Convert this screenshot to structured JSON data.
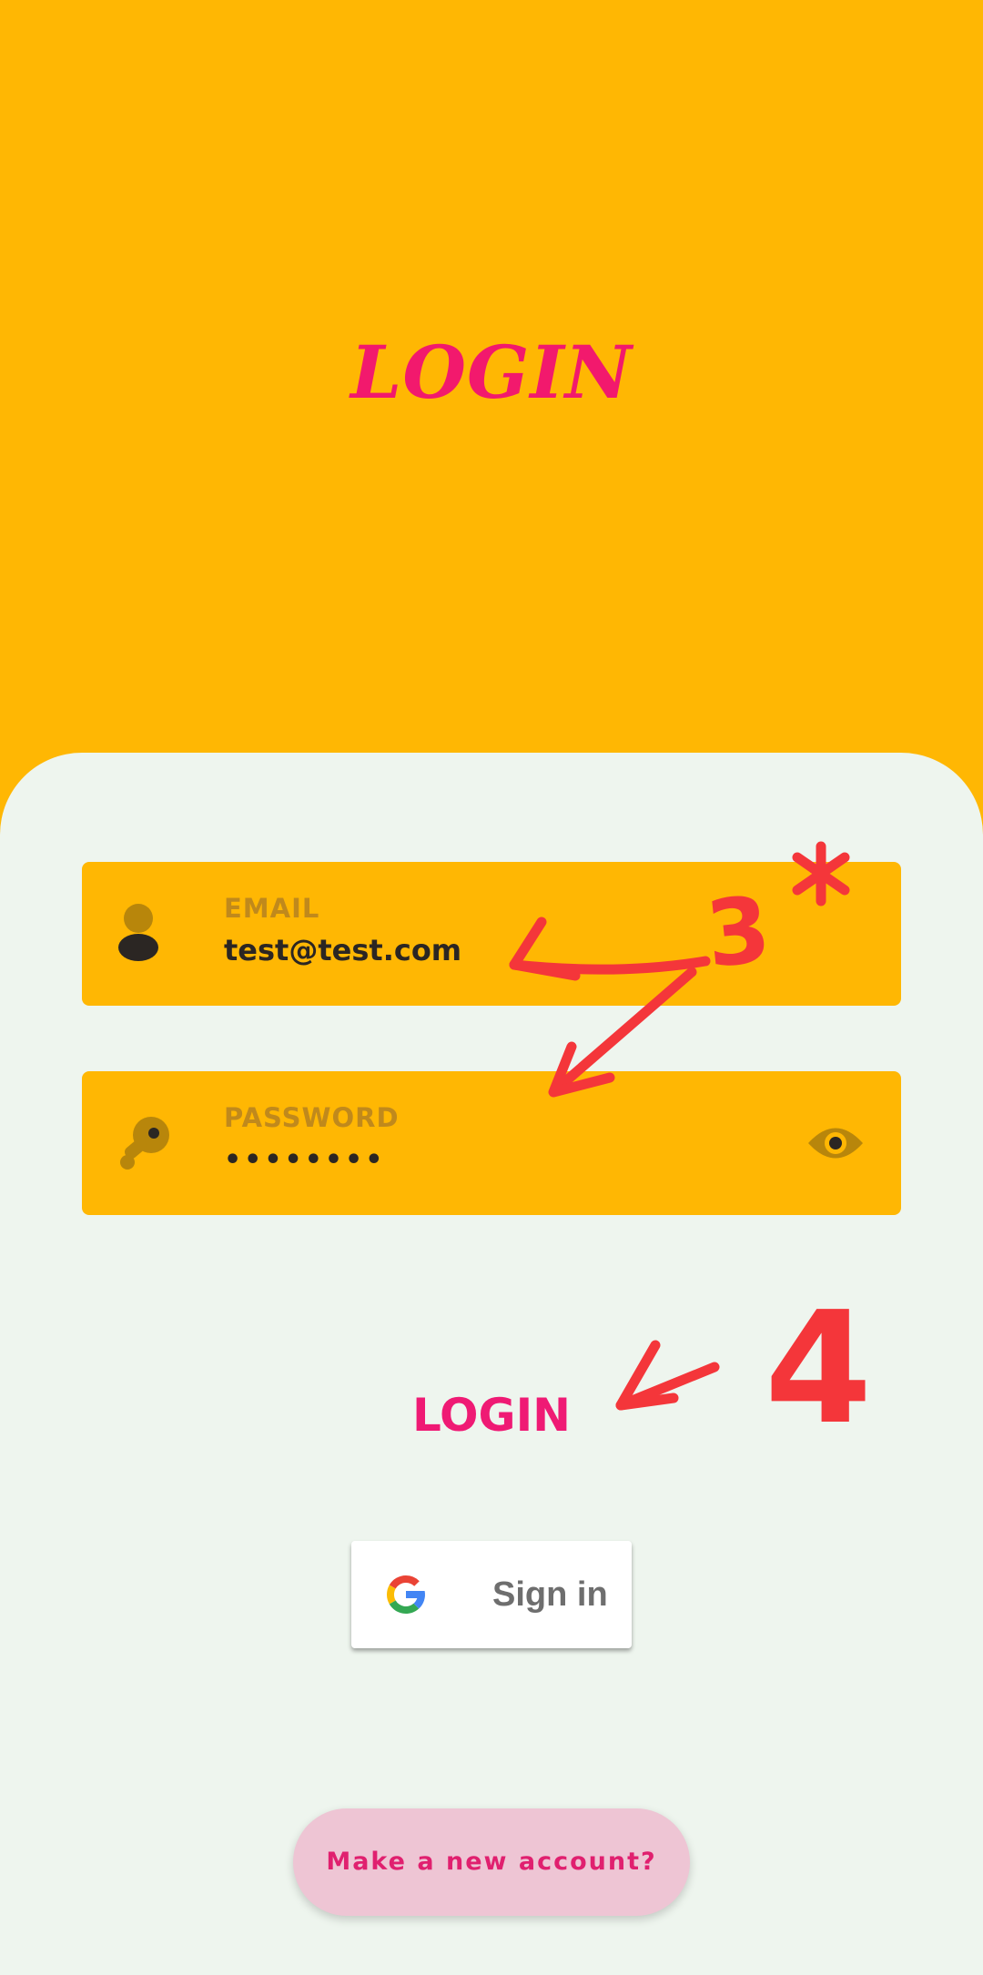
{
  "header": {
    "title": "LOGIN"
  },
  "form": {
    "email": {
      "label": "EMAIL",
      "value": "test@test.com",
      "icon": "user-icon"
    },
    "password": {
      "label": "PASSWORD",
      "value": "••••••••",
      "icon": "key-icon",
      "toggle_icon": "eye-icon"
    }
  },
  "actions": {
    "login_label": "LOGIN",
    "google_label": "Sign in",
    "new_account_label": "Make a new account?"
  },
  "annotations": {
    "number_3": "3",
    "number_4": "4",
    "asterisk": "*"
  },
  "colors": {
    "primary": "#FFB703",
    "accent": "#F2196D",
    "panel": "#EEF5EE",
    "annotation": "#F4363A"
  }
}
